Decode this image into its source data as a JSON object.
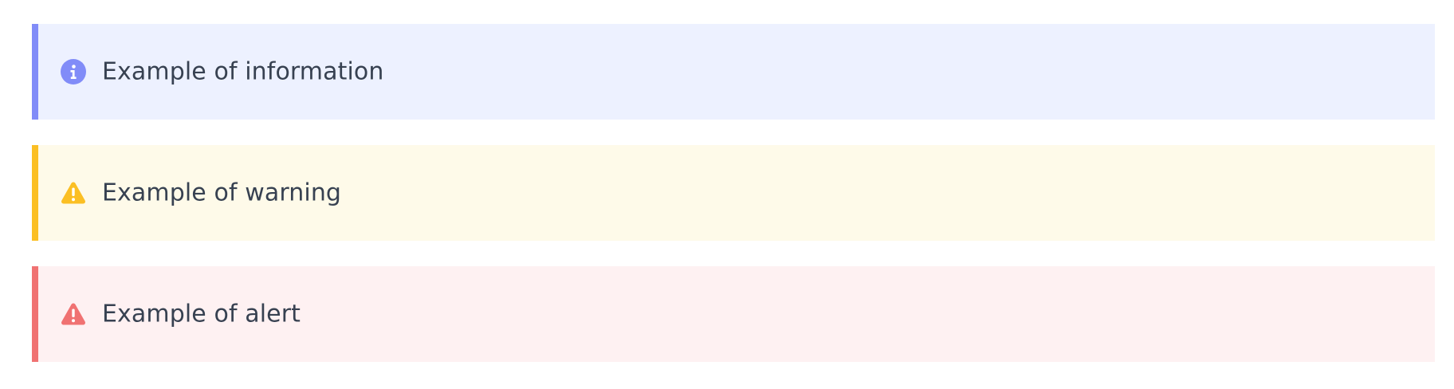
{
  "alerts": [
    {
      "kind": "info",
      "icon": "info-circle-icon",
      "color": "#818cf8",
      "background": "#edf1ff",
      "message": "Example of information"
    },
    {
      "kind": "warning",
      "icon": "warning-triangle-icon",
      "color": "#fbbf24",
      "background": "#fefae9",
      "message": "Example of warning"
    },
    {
      "kind": "alert",
      "icon": "alert-triangle-icon",
      "color": "#f07272",
      "background": "#fef1f2",
      "message": "Example of alert"
    }
  ]
}
